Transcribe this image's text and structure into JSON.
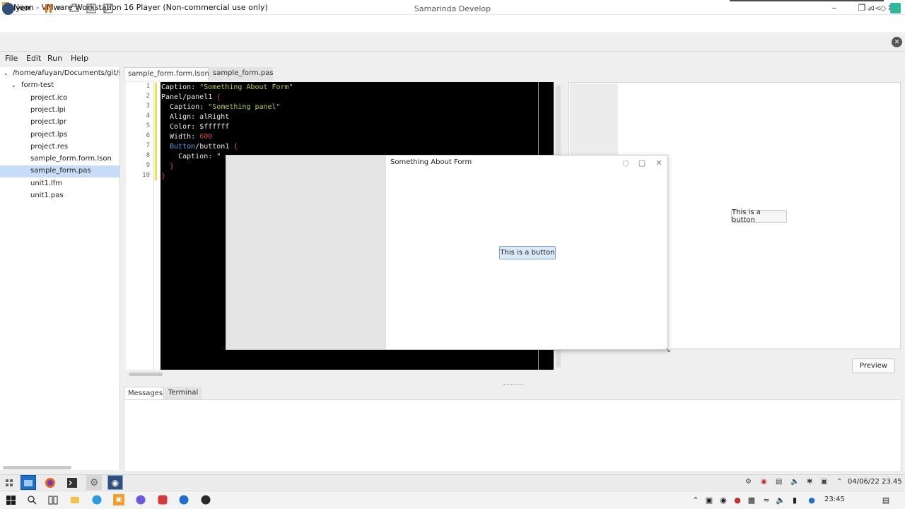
{
  "vmware": {
    "title": "Neon - VMware Workstation 16 Player (Non-commercial use only)",
    "player_menu": "Player",
    "toolbar_right_label": "⊲<"
  },
  "app": {
    "title": "Samarinda Develop"
  },
  "menubar": {
    "items": [
      "File",
      "Edit",
      "Run",
      "Help"
    ]
  },
  "file_tree": {
    "root": "/home/afuyan/Documents/git/sa",
    "folder": "form-test",
    "files": [
      "project.ico",
      "project.lpi",
      "project.lpr",
      "project.lps",
      "project.res",
      "sample_form.form.lson",
      "sample_form.pas",
      "unit1.lfm",
      "unit1.pas"
    ],
    "selected": "sample_form.pas"
  },
  "editor": {
    "tabs": [
      "sample_form.form.lson",
      "sample_form.pas"
    ],
    "line_numbers": [
      "1",
      "2",
      "3",
      "4",
      "5",
      "6",
      "7",
      "8",
      "9",
      "10"
    ],
    "lines": {
      "l1_key": "Caption: ",
      "l1_val": "\"Something About Form\"",
      "l2_key": "Panel/panel1 ",
      "l2_brace": "{",
      "l3_key": "  Caption: ",
      "l3_val": "\"Something panel\"",
      "l4": "  Align: alRight",
      "l5": "  Color: $ffffff",
      "l6_key": "  Width: ",
      "l6_val": "600",
      "l7_type": "  Button",
      "l7_key": "/button1 ",
      "l7_brace": "{",
      "l8": "    Caption: \"",
      "l9": "  }",
      "l10": "}"
    }
  },
  "preview": {
    "button_label": "This is a button",
    "action_label": "Preview"
  },
  "floating_form": {
    "title": "Something About Form",
    "button_label": "This is a button"
  },
  "bottom_panel": {
    "tabs": [
      "Messages",
      "Terminal"
    ]
  },
  "guest_taskbar": {
    "clock": "04/06/22 23.45"
  },
  "host_taskbar": {
    "clock": "23:45"
  },
  "colors": {
    "editor_bg": "#000000",
    "selection": "#c6dcf7",
    "string": "#b9c94a",
    "type": "#4aa3e8",
    "number": "#d44a4a"
  }
}
